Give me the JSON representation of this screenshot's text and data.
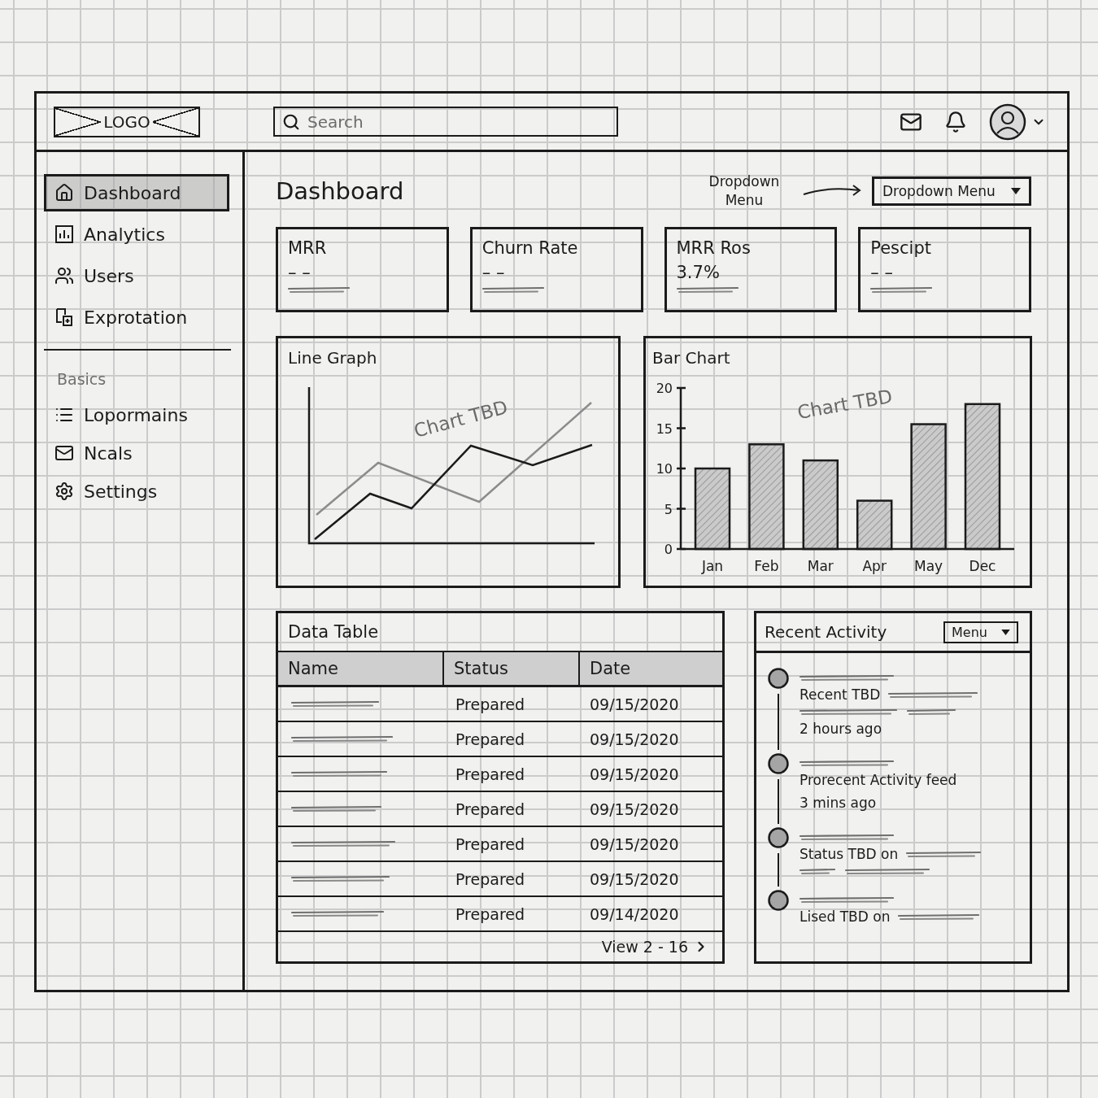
{
  "header": {
    "logo": "LOGO",
    "search": {
      "placeholder": "Search"
    }
  },
  "sidebar": {
    "items": [
      {
        "label": "Dashboard",
        "selected": true
      },
      {
        "label": "Analytics",
        "selected": false
      },
      {
        "label": "Users",
        "selected": false
      },
      {
        "label": "Exprotation",
        "selected": false
      }
    ],
    "section": {
      "title": "Basics",
      "items": [
        {
          "label": "Lopormains",
          "selected": false
        },
        {
          "label": "Ncals",
          "selected": false
        },
        {
          "label": "Settings",
          "selected": false
        }
      ]
    }
  },
  "page": {
    "title": "Dashboard",
    "annotation": "Dropdown Menu",
    "dropdown": "Dropdown Menu"
  },
  "kpis": [
    {
      "label": "MRR",
      "value": "– –"
    },
    {
      "label": "Churn Rate",
      "value": "– –"
    },
    {
      "label": "MRR Ros",
      "value": "3.7%"
    },
    {
      "label": "Pescipt",
      "value": "– –"
    }
  ],
  "line_graph": {
    "title": "Line Graph",
    "overlay_text": "Chart TBD"
  },
  "bar_chart": {
    "chart_data": {
      "type": "bar",
      "title": "Bar Chart",
      "categories": [
        "Jan",
        "Feb",
        "Mar",
        "Apr",
        "May",
        "Dec"
      ],
      "values": [
        10,
        13,
        11,
        6,
        15.5,
        18
      ],
      "ylim": [
        0,
        20
      ],
      "yticks": [
        0,
        5,
        10,
        15,
        20
      ],
      "annotations": [
        "Chart TBD"
      ]
    }
  },
  "data_table": {
    "title": "Data Table",
    "columns": [
      "Name",
      "Status",
      "Date"
    ],
    "rows": [
      {
        "status": "Prepared",
        "date": "09/15/2020"
      },
      {
        "status": "Prepared",
        "date": "09/15/2020"
      },
      {
        "status": "Prepared",
        "date": "09/15/2020"
      },
      {
        "status": "Prepared",
        "date": "09/15/2020"
      },
      {
        "status": "Prepared",
        "date": "09/15/2020"
      },
      {
        "status": "Prepared",
        "date": "09/15/2020"
      },
      {
        "status": "Prepared",
        "date": "09/14/2020"
      }
    ],
    "pagination": "View 2 - 16"
  },
  "recent_activity": {
    "title": "Recent Activity",
    "menu": "Menu",
    "items": [
      {
        "text": "Recent TBD",
        "time": "2 hours ago"
      },
      {
        "text": "Prorecent Activity feed",
        "time": "3 mins ago"
      },
      {
        "text": "Status TBD on"
      },
      {
        "text": "Lised TBD on"
      }
    ]
  }
}
